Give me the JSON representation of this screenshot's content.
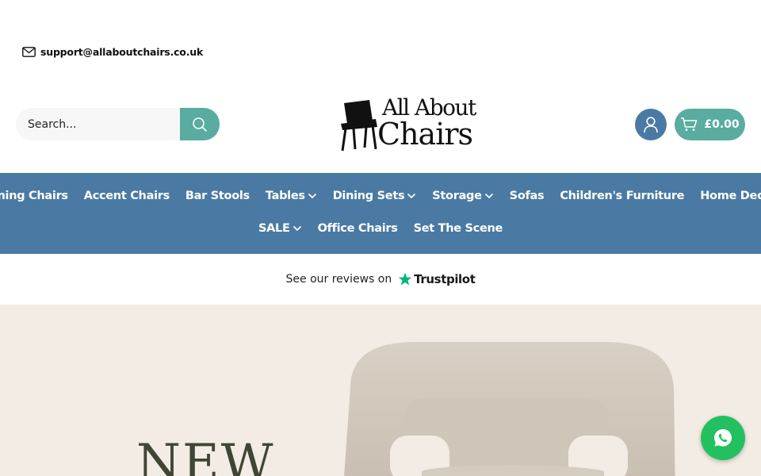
{
  "topbar": {
    "email": "support@allaboutchairs.co.uk",
    "icon": "mail-icon"
  },
  "header": {
    "search": {
      "placeholder": "Search..."
    },
    "logo": {
      "line1": "All About",
      "line2": "Chairs"
    },
    "cart": {
      "total": "£0.00"
    }
  },
  "nav": {
    "row1": [
      {
        "label": "Dining Chairs",
        "dropdown": false
      },
      {
        "label": "Accent Chairs",
        "dropdown": false
      },
      {
        "label": "Bar Stools",
        "dropdown": false
      },
      {
        "label": "Tables",
        "dropdown": true
      },
      {
        "label": "Dining Sets",
        "dropdown": true
      },
      {
        "label": "Storage",
        "dropdown": true
      },
      {
        "label": "Sofas",
        "dropdown": false
      },
      {
        "label": "Children's Furniture",
        "dropdown": false
      },
      {
        "label": "Home Decor",
        "dropdown": false
      }
    ],
    "row2": [
      {
        "label": "SALE",
        "dropdown": true
      },
      {
        "label": "Office Chairs",
        "dropdown": false
      },
      {
        "label": "Set The Scene",
        "dropdown": false
      }
    ]
  },
  "reviews": {
    "text": "See our reviews on",
    "brand": "Trustpilot"
  },
  "hero": {
    "headline": "NEW"
  },
  "colors": {
    "nav": "#4a7aa3",
    "accent": "#5aaba0",
    "hero_bg": "#f3ece4",
    "whatsapp": "#23c060"
  }
}
